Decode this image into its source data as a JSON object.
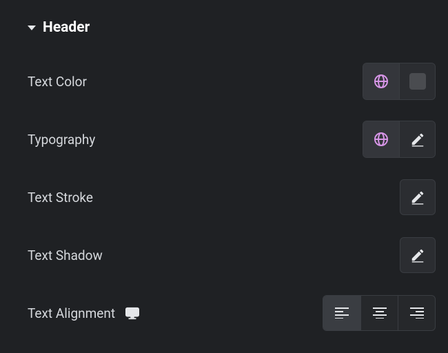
{
  "section": {
    "title": "Header"
  },
  "rows": {
    "textColor": {
      "label": "Text Color",
      "swatch": "#4a4c50"
    },
    "typography": {
      "label": "Typography"
    },
    "textStroke": {
      "label": "Text Stroke"
    },
    "textShadow": {
      "label": "Text Shadow"
    },
    "textAlign": {
      "label": "Text Alignment",
      "selected": "left",
      "options": [
        "left",
        "center",
        "right"
      ]
    }
  },
  "icons": {
    "globe": "globe-icon",
    "pencil": "pencil-icon",
    "swatch": "color-swatch",
    "desktop": "desktop-icon",
    "alignLeft": "align-left-icon",
    "alignCenter": "align-center-icon",
    "alignRight": "align-right-icon",
    "collapse": "collapse-triangle"
  },
  "colors": {
    "accent": "#d695e6",
    "bg": "#1f2124",
    "panel": "#2b2d31",
    "border": "#3a3d42"
  }
}
